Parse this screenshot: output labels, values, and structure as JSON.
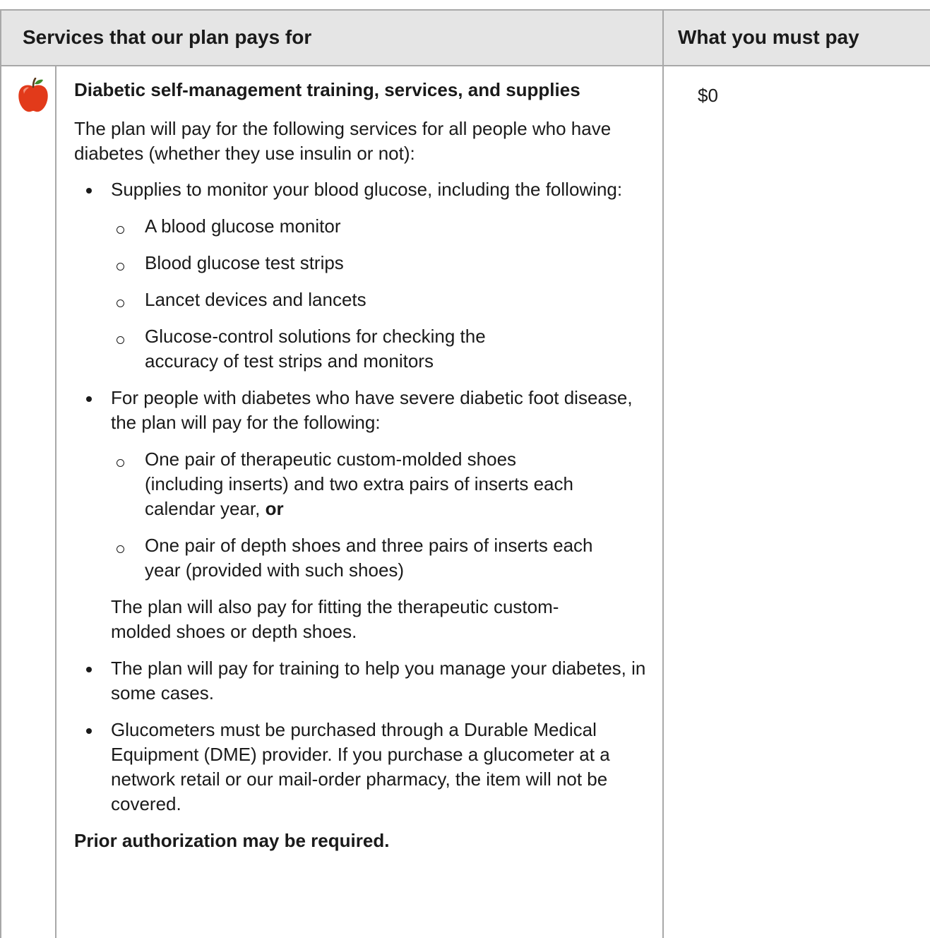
{
  "header": {
    "services_label": "Services that our plan pays for",
    "pay_label": "What you must pay"
  },
  "icons": {
    "row_icon": "apple-icon"
  },
  "row": {
    "title": "Diabetic self-management training, services, and supplies",
    "cost": "$0",
    "intro": "The plan will pay for the following services for all people who have diabetes (whether they use insulin or not):",
    "bullet_1": "Supplies to monitor your blood glucose, including the following:",
    "bullet_1_subs": [
      "A blood glucose monitor",
      "Blood glucose test strips",
      "Lancet devices and lancets",
      "Glucose-control solutions for checking the accuracy of test strips and monitors"
    ],
    "bullet_2": "For people with diabetes who have severe diabetic foot disease, the plan will pay for the following:",
    "bullet_2_sub_1": "One pair of therapeutic custom-molded shoes (including inserts) and two extra pairs of inserts each calendar year,",
    "bullet_2_sub_1_bold": "or",
    "bullet_2_sub_2": "One pair of depth shoes and three pairs of inserts each year (provided with such shoes)",
    "bullet_2_note": "The plan will also pay for fitting the therapeutic custom-molded shoes or depth shoes.",
    "bullet_3": "The plan will pay for training to help you manage your diabetes, in some cases.",
    "bullet_4": "Glucometers must be purchased through a Durable Medical Equipment (DME) provider. If you purchase a glucometer at a network retail or our mail-order pharmacy, the item will not be covered.",
    "prior_auth": "Prior authorization may be required."
  }
}
